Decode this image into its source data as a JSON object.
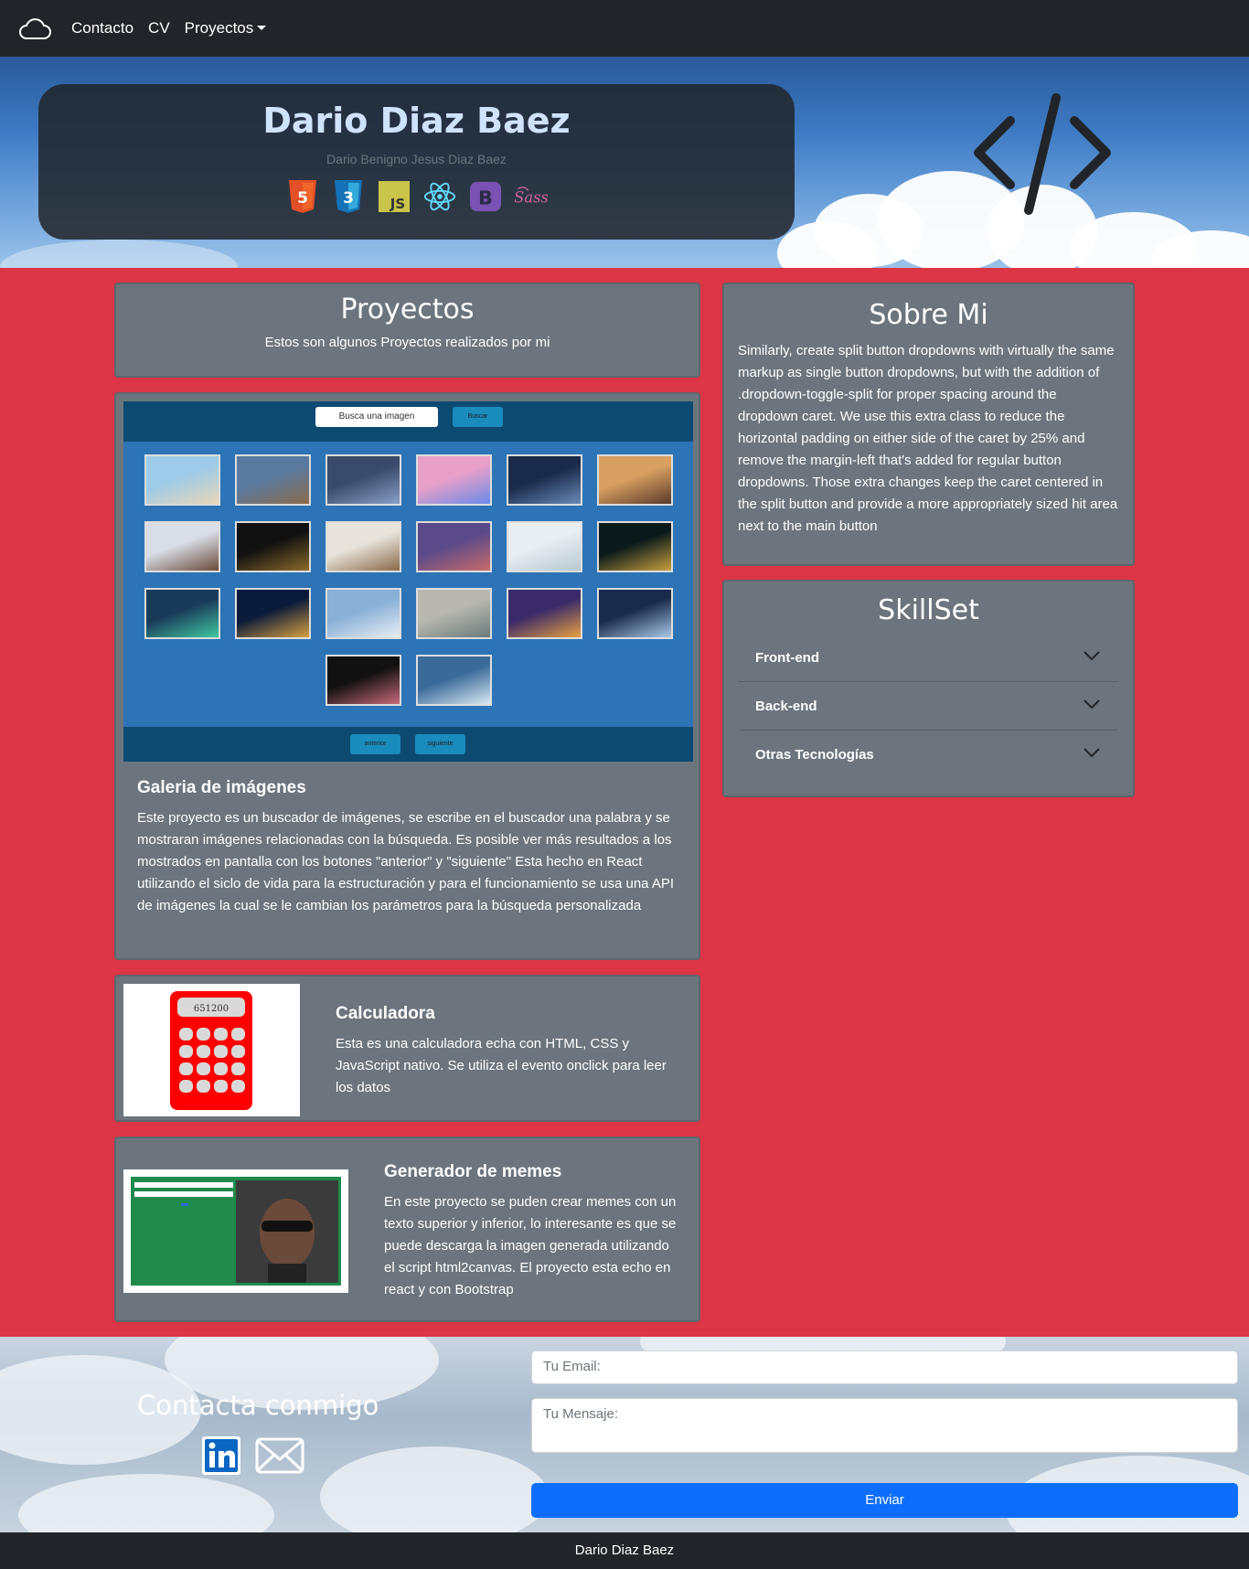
{
  "nav": {
    "brand_icon": "cloud-icon",
    "links": [
      "Contacto",
      "CV"
    ],
    "dropdown_label": "Proyectos"
  },
  "hero": {
    "name": "Dario Diaz Baez",
    "full_name": "Dario Benigno Jesus Diaz Baez",
    "tech_icons": [
      "html5-icon",
      "css3-icon",
      "javascript-icon",
      "react-icon",
      "bootstrap-icon",
      "sass-icon"
    ],
    "side_icon": "code-slash-icon"
  },
  "projects": {
    "title": "Proyectos",
    "subtitle": "Estos son algunos Proyectos realizados por mi",
    "gallery": {
      "title": "Galeria de imágenes",
      "description": "Este proyecto es un buscador de imágenes, se escribe en el buscador una palabra y se mostraran imágenes relacionadas con la búsqueda. Es posible ver más resultados a los mostrados en pantalla con los botones \"anterior\" y \"siguiente\" Esta hecho en React utilizando el siclo de vida para la estructuración y para el funcionamiento se usa una API de imágenes la cual se le cambian los parámetros para la búsqueda personalizada",
      "screenshot": {
        "search_placeholder": "Busca una imagen",
        "search_button": "Buscar",
        "prev_button": "anterior",
        "next_button": "siguiente"
      }
    },
    "calculator": {
      "title": "Calculadora",
      "description": "Esta es una calculadora echa con HTML, CSS y JavaScript nativo. Se utiliza el evento onclick para leer los datos",
      "display": "651200"
    },
    "memes": {
      "title": "Generador de memes",
      "description": "En este proyecto se puden crear memes con un texto superior y inferior, lo interesante es que se puede descarga la imagen generada utilizando el script html2canvas. El proyecto esta echo en react y con Bootstrap"
    }
  },
  "about": {
    "title": "Sobre Mi",
    "text": "Similarly, create split button dropdowns with virtually the same markup as single button dropdowns, but with the addition of .dropdown-toggle-split for proper spacing around the dropdown caret. We use this extra class to reduce the horizontal padding on either side of the caret by 25% and remove the margin-left that's added for regular button dropdowns. Those extra changes keep the caret centered in the split button and provide a more appropriately sized hit area next to the main button"
  },
  "skills": {
    "title": "SkillSet",
    "items": [
      "Front-end",
      "Back-end",
      "Otras Tecnologías"
    ]
  },
  "contact": {
    "title": "Contacta conmigo",
    "social_icons": [
      "linkedin-icon",
      "envelope-icon"
    ],
    "email_placeholder": "Tu Email:",
    "message_placeholder": "Tu Mensaje:",
    "send_label": "Enviar"
  },
  "footer": {
    "text": "Dario Diaz Baez"
  },
  "colors": {
    "navbar": "#212529",
    "page_bg": "#dc3545",
    "card_bg": "#6c757d",
    "primary": "#0d6efd"
  }
}
